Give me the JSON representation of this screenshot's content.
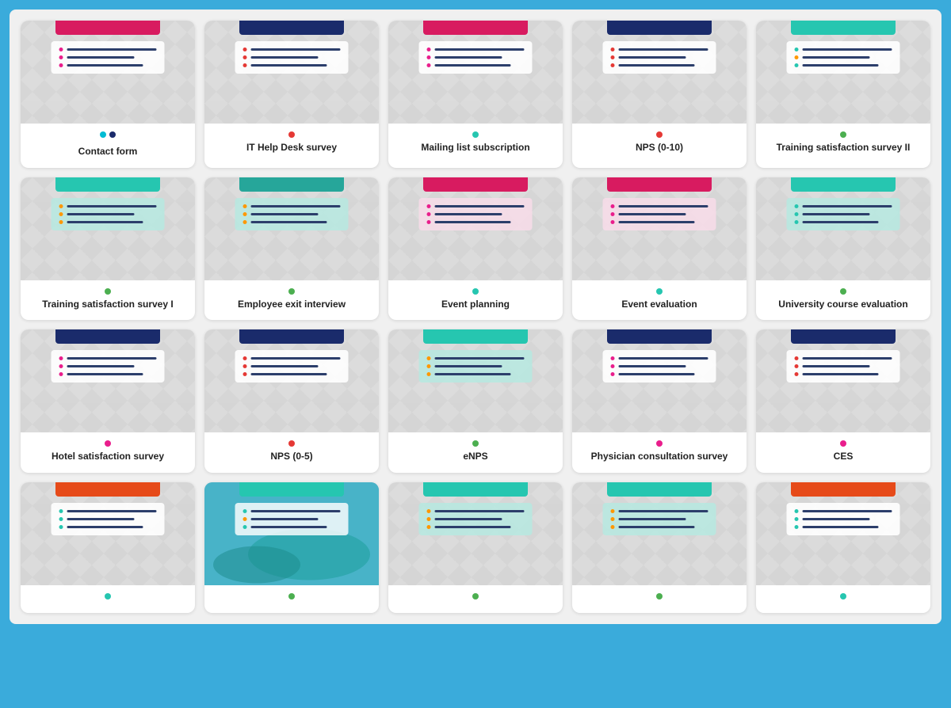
{
  "cards": [
    {
      "id": "contact-form",
      "title": "Contact form",
      "accent": "crimson",
      "dot_color": "cyan",
      "dot_color2": "navy",
      "has_pair": true,
      "form_bg": "white",
      "dot_colors": [
        "crimson",
        "crimson",
        "crimson"
      ]
    },
    {
      "id": "it-help-desk",
      "title": "IT Help Desk survey",
      "accent": "navy",
      "dot_color": "orange-red",
      "has_pair": false,
      "form_bg": "white",
      "dot_colors": [
        "orange-red",
        "orange-red",
        "orange-red"
      ]
    },
    {
      "id": "mailing-list",
      "title": "Mailing list subscription",
      "accent": "crimson",
      "dot_color": "teal",
      "has_pair": false,
      "form_bg": "white",
      "dot_colors": [
        "pink",
        "pink",
        "pink"
      ]
    },
    {
      "id": "nps-0-10",
      "title": "NPS (0-10)",
      "accent": "navy",
      "dot_color": "orange-red",
      "has_pair": false,
      "form_bg": "white",
      "dot_colors": [
        "orange-red",
        "orange-red",
        "orange-red"
      ]
    },
    {
      "id": "training-satisfaction-2",
      "title": "Training satisfaction survey II",
      "accent": "teal",
      "dot_color": "green",
      "has_pair": false,
      "form_bg": "white",
      "dot_colors": [
        "teal",
        "orange",
        "teal"
      ]
    },
    {
      "id": "training-satisfaction-1",
      "title": "Training satisfaction survey I",
      "accent": "teal",
      "dot_color": "green",
      "has_pair": false,
      "form_bg": "light-teal",
      "dot_colors": [
        "orange",
        "orange",
        "orange"
      ]
    },
    {
      "id": "employee-exit",
      "title": "Employee exit interview",
      "accent": "green-teal",
      "dot_color": "green",
      "has_pair": false,
      "form_bg": "light-teal",
      "dot_colors": [
        "orange",
        "orange",
        "orange"
      ]
    },
    {
      "id": "event-planning",
      "title": "Event planning",
      "accent": "crimson",
      "dot_color": "teal",
      "has_pair": false,
      "form_bg": "light-pink",
      "dot_colors": [
        "pink",
        "pink",
        "pink"
      ]
    },
    {
      "id": "event-evaluation",
      "title": "Event evaluation",
      "accent": "crimson",
      "dot_color": "teal",
      "has_pair": false,
      "form_bg": "light-pink",
      "dot_colors": [
        "pink",
        "pink",
        "pink"
      ]
    },
    {
      "id": "university-course",
      "title": "University course evaluation",
      "accent": "teal",
      "dot_color": "green",
      "has_pair": false,
      "form_bg": "light-teal",
      "dot_colors": [
        "teal",
        "teal",
        "teal"
      ]
    },
    {
      "id": "hotel-satisfaction",
      "title": "Hotel satisfaction survey",
      "accent": "navy",
      "dot_color": "crimson",
      "has_pair": false,
      "form_bg": "white",
      "dot_colors": [
        "pink",
        "pink",
        "pink"
      ]
    },
    {
      "id": "nps-0-5",
      "title": "NPS (0-5)",
      "accent": "navy",
      "dot_color": "orange-red",
      "has_pair": false,
      "form_bg": "white",
      "dot_colors": [
        "orange-red",
        "orange-red",
        "orange-red"
      ]
    },
    {
      "id": "enps",
      "title": "eNPS",
      "accent": "teal",
      "dot_color": "green",
      "has_pair": false,
      "form_bg": "light-teal",
      "dot_colors": [
        "orange",
        "orange",
        "orange"
      ]
    },
    {
      "id": "physician-consultation",
      "title": "Physician consultation survey",
      "accent": "navy",
      "dot_color": "crimson",
      "has_pair": false,
      "form_bg": "white",
      "dot_colors": [
        "pink",
        "pink",
        "pink"
      ]
    },
    {
      "id": "ces",
      "title": "CES",
      "accent": "navy",
      "dot_color": "crimson",
      "has_pair": false,
      "form_bg": "white",
      "dot_colors": [
        "orange-red",
        "orange-red",
        "orange-red"
      ]
    },
    {
      "id": "row4-1",
      "title": "",
      "accent": "orange",
      "dot_color": "teal",
      "has_pair": false,
      "form_bg": "white",
      "dot_colors": [
        "teal",
        "teal",
        "teal"
      ]
    },
    {
      "id": "row4-2",
      "title": "",
      "accent": "teal",
      "dot_color": "green",
      "has_pair": false,
      "form_bg": "photo",
      "dot_colors": [
        "teal",
        "orange",
        "teal"
      ]
    },
    {
      "id": "row4-3",
      "title": "",
      "accent": "teal",
      "dot_color": "green",
      "has_pair": false,
      "form_bg": "light-teal",
      "dot_colors": [
        "orange",
        "orange",
        "orange"
      ]
    },
    {
      "id": "row4-4",
      "title": "",
      "accent": "teal",
      "dot_color": "green",
      "has_pair": false,
      "form_bg": "light-teal",
      "dot_colors": [
        "orange",
        "orange",
        "orange"
      ]
    },
    {
      "id": "row4-5",
      "title": "",
      "accent": "orange",
      "dot_color": "teal",
      "has_pair": false,
      "form_bg": "white",
      "dot_colors": [
        "teal",
        "teal",
        "teal"
      ]
    }
  ]
}
